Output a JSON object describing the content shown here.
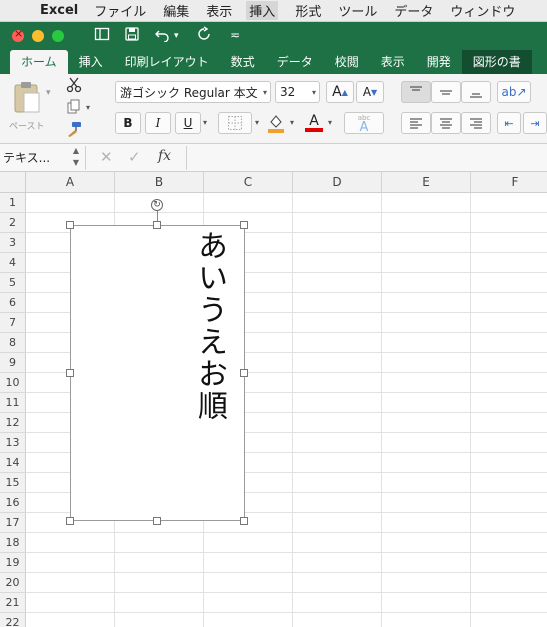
{
  "menubar": {
    "app_name": "Excel",
    "items": [
      "ファイル",
      "編集",
      "表示",
      "挿入",
      "形式",
      "ツール",
      "データ",
      "ウィンドウ"
    ]
  },
  "tabs": [
    "ホーム",
    "挿入",
    "印刷レイアウト",
    "数式",
    "データ",
    "校閲",
    "表示",
    "開発",
    "図形の書"
  ],
  "ribbon": {
    "paste_label": "ペースト",
    "font_name": "游ゴシック Regular 本文",
    "font_size": "32",
    "bold_label": "B",
    "italic_label": "I",
    "underline_label": "U",
    "grow_font_label": "A",
    "shrink_font_label": "A",
    "phonetic_label": "abc",
    "font_color_label": "A",
    "colors": {
      "fill_color": "#f0a030",
      "font_color": "#e00000",
      "ribbon_green": "#1e7145"
    }
  },
  "formula_bar": {
    "name_box": "テキス...",
    "fx_label": "fx",
    "content": ""
  },
  "grid": {
    "columns": [
      "A",
      "B",
      "C",
      "D",
      "E",
      "F"
    ],
    "rows": [
      "1",
      "2",
      "3",
      "4",
      "5",
      "6",
      "7",
      "8",
      "9",
      "10",
      "11",
      "12",
      "13",
      "14",
      "15",
      "16",
      "17",
      "18",
      "19",
      "20",
      "21",
      "22"
    ]
  },
  "textbox": {
    "text": "あいうえお順",
    "writing_mode": "vertical"
  }
}
